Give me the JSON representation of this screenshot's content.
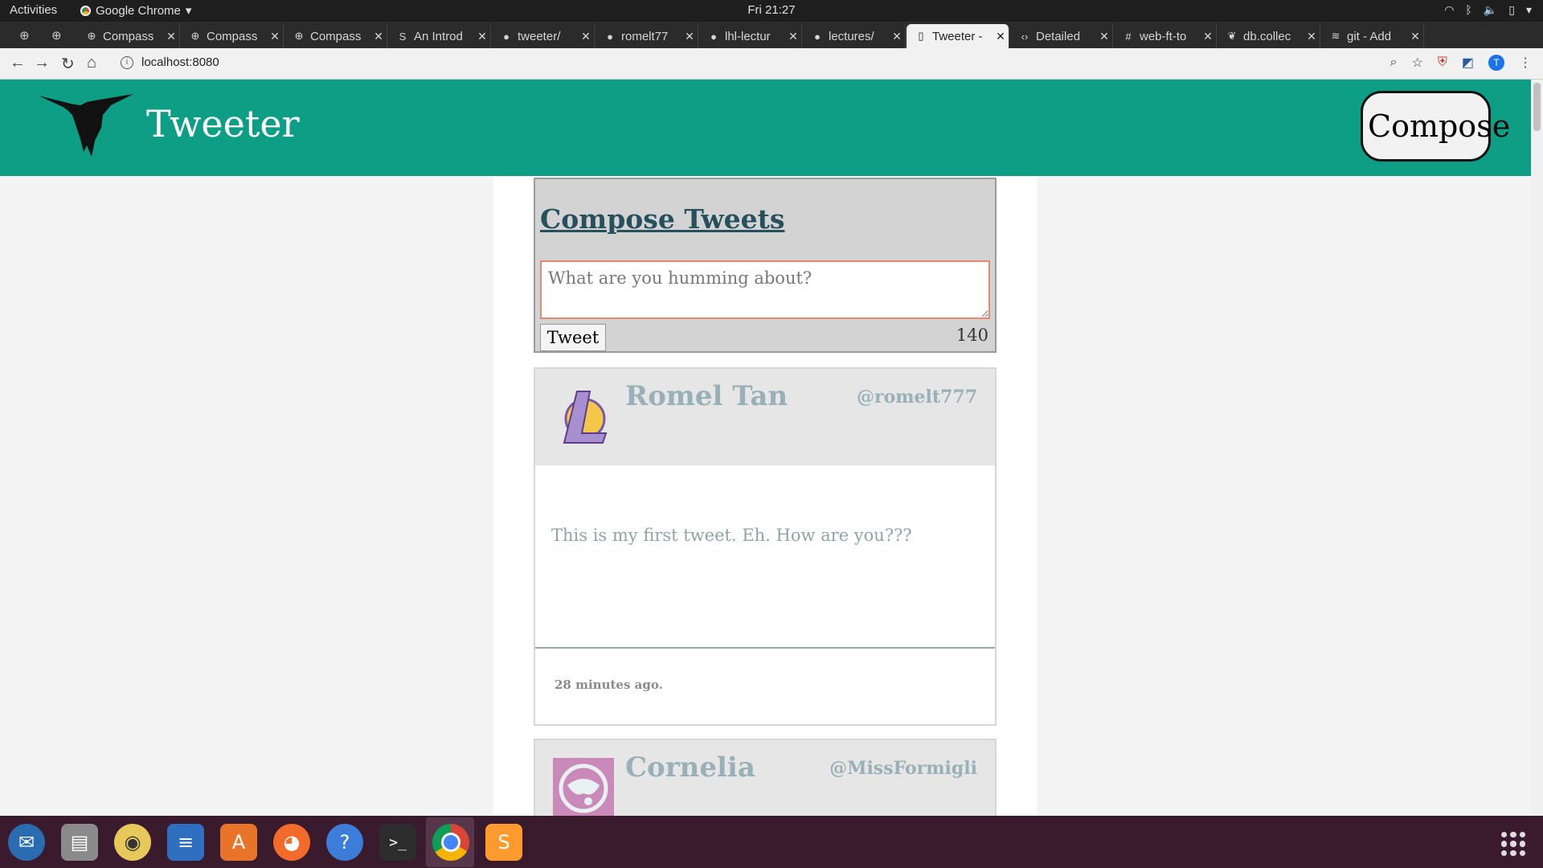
{
  "os": {
    "activities": "Activities",
    "app_name": "Google Chrome",
    "clock": "Fri 21:27"
  },
  "tabs": [
    {
      "label": "Compass",
      "icon": "compass-icon"
    },
    {
      "label": "Compass",
      "icon": "compass-icon"
    },
    {
      "label": "Compass",
      "icon": "compass-icon"
    },
    {
      "label": "An Introd",
      "icon": "s-icon"
    },
    {
      "label": "tweeter/",
      "icon": "github-icon"
    },
    {
      "label": "romelt77",
      "icon": "github-icon"
    },
    {
      "label": "lhl-lectur",
      "icon": "github-icon"
    },
    {
      "label": "lectures/",
      "icon": "github-icon"
    },
    {
      "label": "Tweeter -",
      "icon": "page-icon",
      "active": true
    },
    {
      "label": "Detailed",
      "icon": "code-icon"
    },
    {
      "label": "web-ft-to",
      "icon": "slack-icon"
    },
    {
      "label": "db.collec",
      "icon": "mongodb-icon"
    },
    {
      "label": "git - Add",
      "icon": "stack-icon"
    }
  ],
  "browser": {
    "url": "localhost:8080"
  },
  "app": {
    "brand": "Tweeter",
    "compose_button": "Compose",
    "compose_title": "Compose Tweets",
    "compose_placeholder": "What are you humming about?",
    "tweet_button": "Tweet",
    "counter": "140",
    "accent": "#0e9d85"
  },
  "tweets": [
    {
      "name": "Romel Tan",
      "handle": "@romelt777",
      "text": "This is my first tweet. Eh. How are you???",
      "time": "28 minutes ago.",
      "avatar": "lakers-logo-icon"
    },
    {
      "name": "Cornelia",
      "handle": "@MissFormigli",
      "text": "",
      "time": "",
      "avatar": "cornelia-avatar-icon"
    }
  ]
}
